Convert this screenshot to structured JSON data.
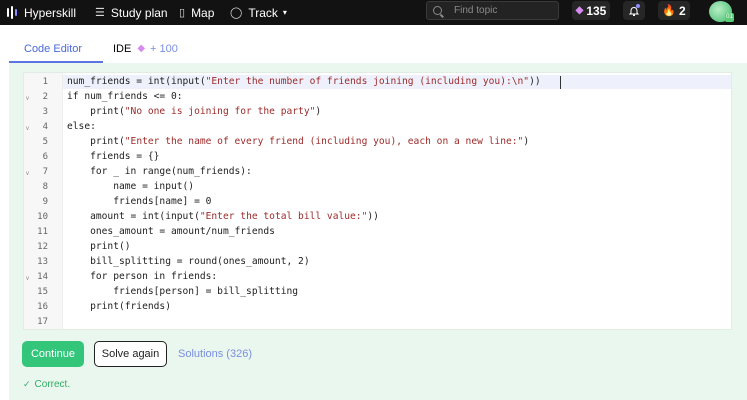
{
  "nav": {
    "brand": "Hyperskill",
    "items": [
      {
        "label": "Study plan",
        "icon": "list-icon"
      },
      {
        "label": "Map",
        "icon": "map-icon"
      },
      {
        "label": "Track",
        "icon": "circle-icon",
        "dropdown": true
      }
    ],
    "search_placeholder": "Find topic",
    "gems": "135",
    "streak": "2"
  },
  "tabs": [
    {
      "label": "Code Editor",
      "active": true
    },
    {
      "label": "IDE",
      "bonus": "+ 100",
      "active": false
    }
  ],
  "editor": {
    "line_numbers": [
      "1",
      "2",
      "3",
      "4",
      "5",
      "6",
      "7",
      "8",
      "9",
      "10",
      "11",
      "12",
      "13",
      "14",
      "15",
      "16",
      "17"
    ],
    "highlighted_line": 1,
    "fold_markers": [
      2,
      4,
      7,
      14
    ]
  },
  "code": {
    "l1_a": "num_friends = int(input(",
    "l1_s": "\"Enter the number of friends joining (including you):\\n\"",
    "l1_b": "))",
    "l2": "if num_friends <= 0:",
    "l3_a": "    print(",
    "l3_s": "\"No one is joining for the party\"",
    "l3_b": ")",
    "l4": "else:",
    "l5_a": "    print(",
    "l5_s": "\"Enter the name of every friend (including you), each on a new line:\"",
    "l5_b": ")",
    "l6": "    friends = {}",
    "l7": "    for _ in range(num_friends):",
    "l8": "        name = input()",
    "l9": "        friends[name] = 0",
    "l10_a": "    amount = int(input(",
    "l10_s": "\"Enter the total bill value:\"",
    "l10_b": "))",
    "l11": "    ones_amount = amount/num_friends",
    "l12": "    print()",
    "l13": "    bill_splitting = round(ones_amount, 2)",
    "l14": "    for person in friends:",
    "l15": "        friends[person] = bill_splitting",
    "l16": "    print(friends)",
    "l17": ""
  },
  "actions": {
    "continue": "Continue",
    "solve_again": "Solve again",
    "solutions": "Solutions (326)"
  },
  "status": {
    "check": "✓",
    "text": "Correct."
  },
  "colors": {
    "accent": "#4a6ad9",
    "success": "#33c57a",
    "panel": "#eaf7ee",
    "string": "#9c2b2b"
  }
}
